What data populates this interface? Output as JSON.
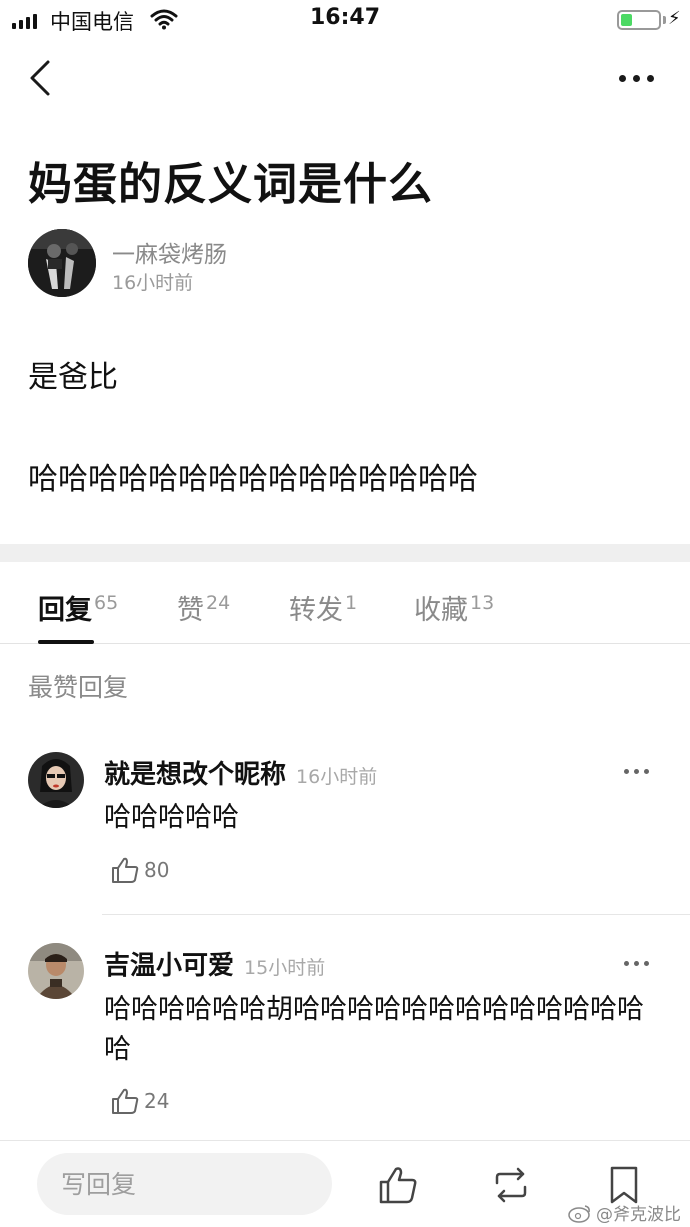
{
  "status_bar": {
    "carrier": "中国电信",
    "time": "16:47",
    "battery_level": 0.3
  },
  "nav": {
    "back_icon": "chevron-left-icon",
    "more_icon": "more-horizontal-icon"
  },
  "post": {
    "title": "妈蛋的反义词是什么",
    "author": "一麻袋烤肠",
    "time": "16小时前",
    "paragraphs": [
      "是爸比",
      "哈哈哈哈哈哈哈哈哈哈哈哈哈哈哈"
    ]
  },
  "tabs": [
    {
      "label": "回复",
      "count": "65",
      "active": true
    },
    {
      "label": "赞",
      "count": "24",
      "active": false
    },
    {
      "label": "转发",
      "count": "1",
      "active": false
    },
    {
      "label": "收藏",
      "count": "13",
      "active": false
    }
  ],
  "section_title": "最赞回复",
  "comments": [
    {
      "name": "就是想改个昵称",
      "time": "16小时前",
      "text": "哈哈哈哈哈",
      "likes": "80"
    },
    {
      "name": "吉温小可爱",
      "time": "15小时前",
      "text": "哈哈哈哈哈哈胡哈哈哈哈哈哈哈哈哈哈哈哈哈哈",
      "likes": "24"
    }
  ],
  "bottom_bar": {
    "reply_placeholder": "写回复",
    "icons": [
      "thumbs-up-icon",
      "repost-icon",
      "bookmark-icon"
    ]
  },
  "watermark": "@斧克波比",
  "colors": {
    "text": "#111111",
    "secondary": "#8a8a8a",
    "battery_fill": "#4cd964",
    "divider": "#efefef"
  }
}
